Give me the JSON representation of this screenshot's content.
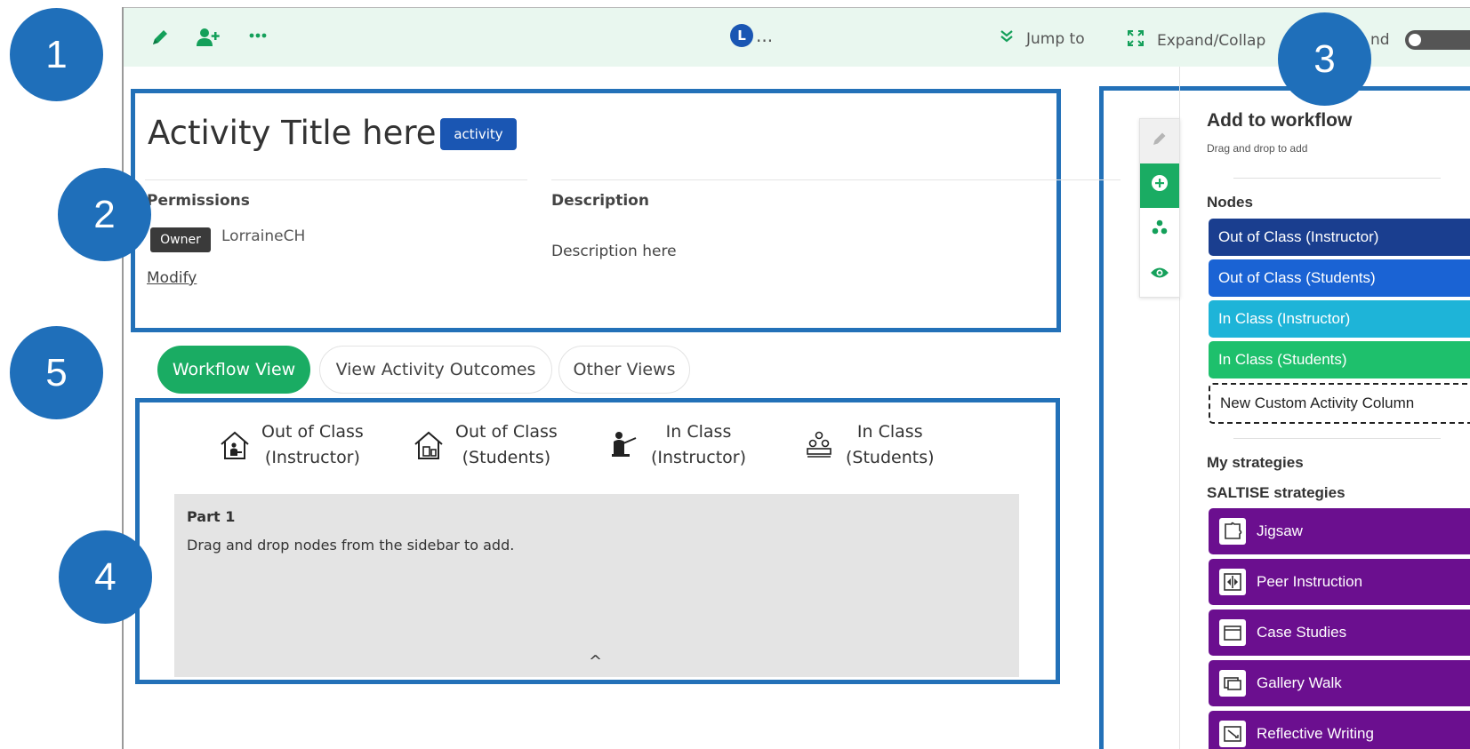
{
  "toolbar": {
    "avatar_letter": "L",
    "ellipsis": "...",
    "jump_to": "Jump to",
    "expand_collapse": "Expand/Collap",
    "expand_tail": "nd",
    "more": "..."
  },
  "markers": [
    "1",
    "2",
    "3",
    "4",
    "5"
  ],
  "header": {
    "title": "Activity Title here",
    "type_badge": "activity",
    "permissions_label": "Permissions",
    "owner_badge": "Owner",
    "owner_name": "LorraineCH",
    "modify_link": "Modify",
    "description_label": "Description",
    "description_text": "Description here"
  },
  "tabs": [
    "Workflow View",
    "View Activity Outcomes",
    "Other Views"
  ],
  "columns": [
    {
      "line1": "Out of Class",
      "line2": "(Instructor)",
      "icon": "house-instructor-icon"
    },
    {
      "line1": "Out of Class",
      "line2": "(Students)",
      "icon": "house-students-icon"
    },
    {
      "line1": "In Class",
      "line2": "(Instructor)",
      "icon": "instructor-lecturing-icon"
    },
    {
      "line1": "In Class",
      "line2": "(Students)",
      "icon": "students-group-icon"
    }
  ],
  "part": {
    "title": "Part 1",
    "hint": "Drag and drop nodes from the sidebar to add.",
    "caret": "^"
  },
  "sidebar": {
    "title": "Add to workflow",
    "subtitle": "Drag and drop to add",
    "nodes_label": "Nodes",
    "nodes": [
      {
        "label": "Out of Class (Instructor)",
        "color": "#1a3e8f"
      },
      {
        "label": "Out of Class (Students)",
        "color": "#1a63d4"
      },
      {
        "label": "In Class (Instructor)",
        "color": "#1eb4d8"
      },
      {
        "label": "In Class (Students)",
        "color": "#1ec06c"
      }
    ],
    "custom_node": "New Custom Activity Column",
    "my_strategies_label": "My strategies",
    "saltise_label": "SALTISE strategies",
    "strategies": [
      "Jigsaw",
      "Peer Instruction",
      "Case Studies",
      "Gallery Walk",
      "Reflective Writing"
    ],
    "strategy_color": "#6b0f8f"
  },
  "colors": {
    "accent_green": "#1aac63",
    "highlight_blue": "#2371b8",
    "toolbar_bg": "#e9f7ef"
  }
}
